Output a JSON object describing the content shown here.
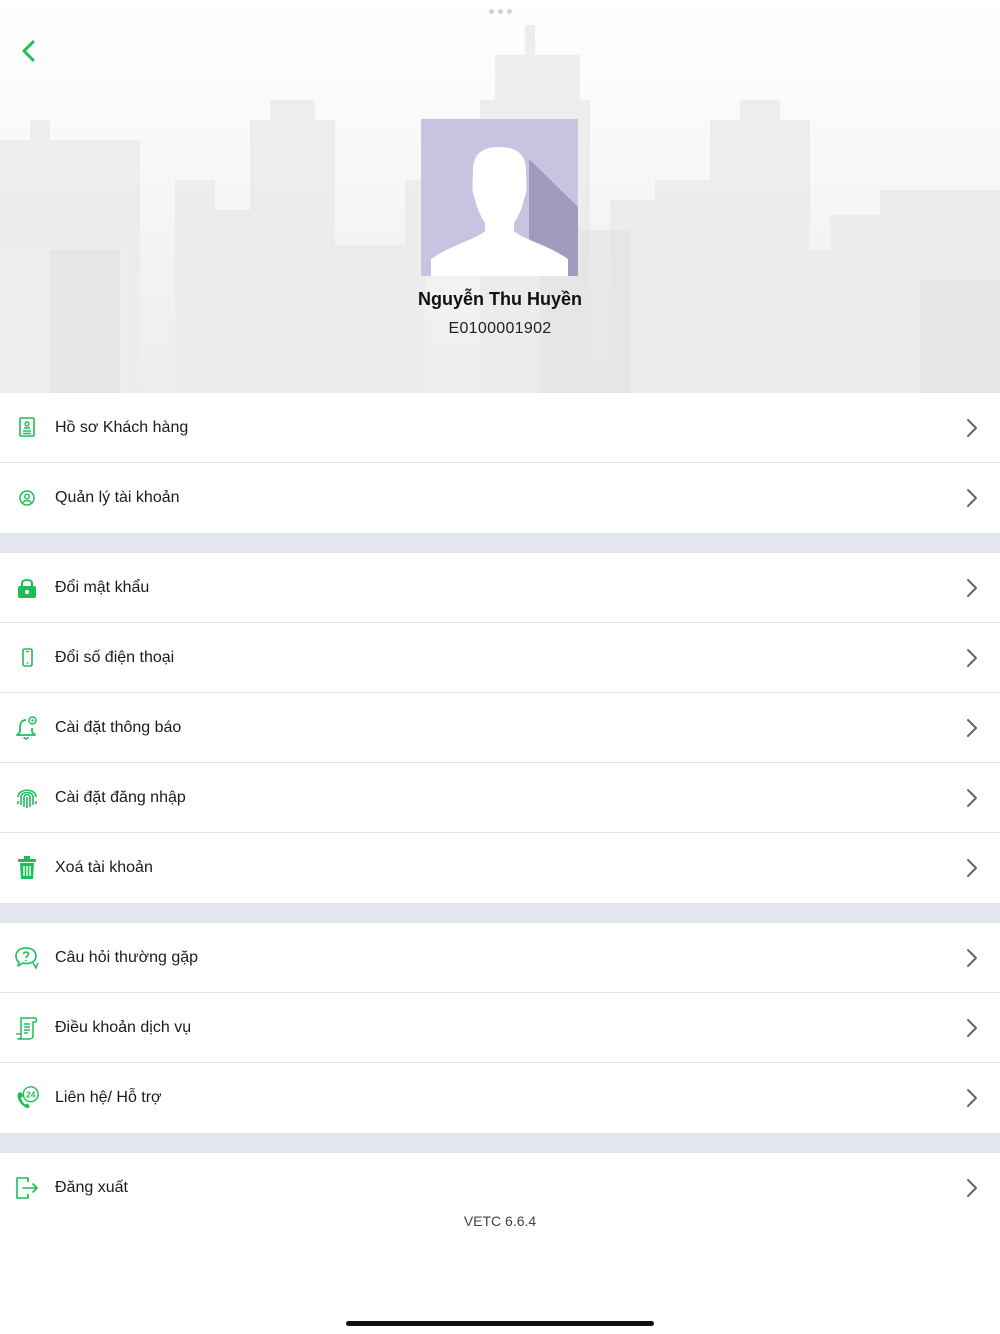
{
  "profile": {
    "name": "Nguyễn Thu Huyền",
    "code": "E0100001902"
  },
  "menu": {
    "group1": [
      {
        "label": "Hồ sơ Khách hàng",
        "icon": "customer-profile-icon"
      },
      {
        "label": "Quản lý tài khoản",
        "icon": "account-user-icon"
      }
    ],
    "group2": [
      {
        "label": "Đổi mật khẩu",
        "icon": "lock-icon"
      },
      {
        "label": "Đổi số điện thoại",
        "icon": "phone-icon"
      },
      {
        "label": "Cài đặt thông báo",
        "icon": "bell-settings-icon"
      },
      {
        "label": "Cài đặt đăng nhập",
        "icon": "fingerprint-icon"
      },
      {
        "label": "Xoá tài khoản",
        "icon": "trash-icon"
      }
    ],
    "group3": [
      {
        "label": "Câu hỏi thường gặp",
        "icon": "faq-icon"
      },
      {
        "label": "Điều khoản dịch vụ",
        "icon": "document-icon"
      },
      {
        "label": "Liên hệ/ Hỗ trợ",
        "icon": "support-24-icon"
      }
    ],
    "group4": [
      {
        "label": "Đăng xuất",
        "icon": "logout-icon"
      }
    ]
  },
  "footer": {
    "version": "VETC 6.6.4"
  },
  "colors": {
    "accent": "#1fbd5a",
    "separator": "#e3e6ef",
    "avatar_bg": "#c8c3e0"
  }
}
